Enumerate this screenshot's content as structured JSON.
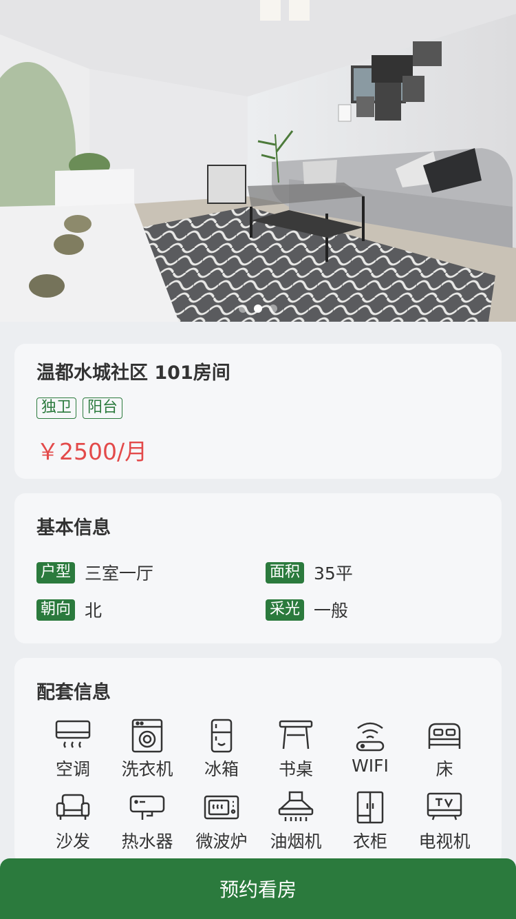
{
  "hero": {
    "slides": 3,
    "active_slide": 2
  },
  "listing": {
    "title": "温都水城社区 101房间",
    "tags": [
      "独卫",
      "阳台"
    ],
    "price": "￥2500/月"
  },
  "basic": {
    "title": "基本信息",
    "items": [
      {
        "key": "户型",
        "value": "三室一厅"
      },
      {
        "key": "面积",
        "value": "35平"
      },
      {
        "key": "朝向",
        "value": "北"
      },
      {
        "key": "采光",
        "value": "一般"
      }
    ]
  },
  "facilities": {
    "title": "配套信息",
    "items": [
      {
        "label": "空调",
        "icon": "air-conditioner-icon"
      },
      {
        "label": "洗衣机",
        "icon": "washing-machine-icon"
      },
      {
        "label": "冰箱",
        "icon": "fridge-icon"
      },
      {
        "label": "书桌",
        "icon": "desk-icon"
      },
      {
        "label": "WIFI",
        "icon": "wifi-router-icon"
      },
      {
        "label": "床",
        "icon": "bed-icon"
      },
      {
        "label": "沙发",
        "icon": "sofa-icon"
      },
      {
        "label": "热水器",
        "icon": "water-heater-icon"
      },
      {
        "label": "微波炉",
        "icon": "microwave-icon"
      },
      {
        "label": "油烟机",
        "icon": "range-hood-icon"
      },
      {
        "label": "衣柜",
        "icon": "wardrobe-icon"
      },
      {
        "label": "电视机",
        "icon": "tv-icon"
      }
    ]
  },
  "actions": {
    "book_label": "预约看房"
  },
  "colors": {
    "primary_green": "#2b7a3d",
    "price_red": "#e34a4a",
    "background": "#eceef1",
    "card": "#f6f7f9"
  }
}
